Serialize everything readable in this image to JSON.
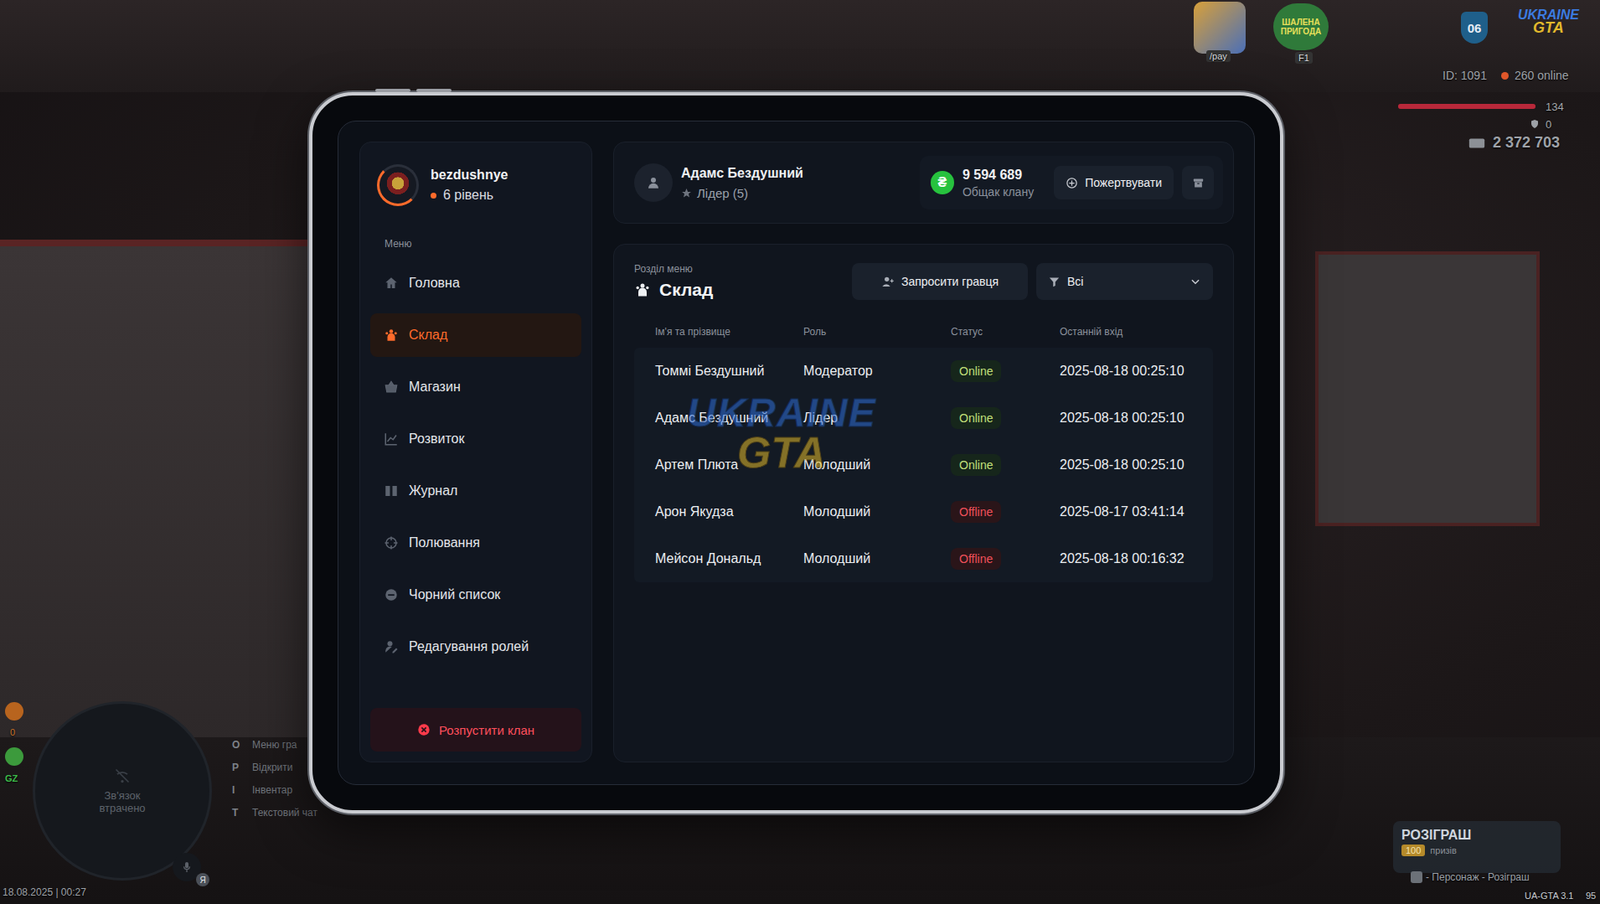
{
  "profile": {
    "name": "bezdushnye",
    "level": "6 рівень"
  },
  "sidebar": {
    "heading": "Меню",
    "items": [
      {
        "label": "Головна",
        "selected": false
      },
      {
        "label": "Склад",
        "selected": true
      },
      {
        "label": "Магазин",
        "selected": false
      },
      {
        "label": "Розвиток",
        "selected": false
      },
      {
        "label": "Журнал",
        "selected": false
      },
      {
        "label": "Полювання",
        "selected": false
      },
      {
        "label": "Чорний список",
        "selected": false
      },
      {
        "label": "Редагування ролей",
        "selected": false
      }
    ],
    "disband": "Розпустити клан"
  },
  "header": {
    "member_name": "Адамс Бездушний",
    "member_role": "Лідер (5)",
    "currency": "₴",
    "balance": "9 594 689",
    "balance_label": "Общак клану",
    "donate": "Пожертвувати"
  },
  "section": {
    "caption": "Розділ меню",
    "title": "Склад",
    "invite": "Запросити гравця",
    "filter": "Всі"
  },
  "table": {
    "columns": [
      "Ім'я та прізвище",
      "Роль",
      "Статус",
      "Останній вхід"
    ],
    "rows": [
      {
        "name": "Томмі Бездушний",
        "role": "Модератор",
        "status": "Online",
        "online": true,
        "last_login": "2025-08-18 00:25:10"
      },
      {
        "name": "Адамс Бездушний",
        "role": "Лідер",
        "status": "Online",
        "online": true,
        "last_login": "2025-08-18 00:25:10"
      },
      {
        "name": "Артем Плюта",
        "role": "Молодший",
        "status": "Online",
        "online": true,
        "last_login": "2025-08-18 00:25:10"
      },
      {
        "name": "Арон Якудза",
        "role": "Молодший",
        "status": "Offline",
        "online": false,
        "last_login": "2025-08-17 03:41:14"
      },
      {
        "name": "Мейсон Дональд",
        "role": "Молодший",
        "status": "Offline",
        "online": false,
        "last_login": "2025-08-18 00:16:32"
      }
    ]
  },
  "watermark": {
    "top": "UKRAINE",
    "bottom": "GTA"
  },
  "hud": {
    "pay_badge": "/pay",
    "event_badge": "ШАЛЕНА ПРИГОДА",
    "event_key": "F1",
    "server_number": "06",
    "logo_top": "UKRAINE",
    "logo_bottom": "GTA",
    "player_id": "ID: 1091",
    "online": "260 online",
    "health": "134",
    "armor": "0",
    "money": "2 372 703",
    "minimap_text": "Зв'язок втрачено",
    "hints": [
      {
        "key": "O",
        "label": "Меню гра"
      },
      {
        "key": "P",
        "label": "Відкрити"
      },
      {
        "key": "I",
        "label": "Інвентар"
      },
      {
        "key": "T",
        "label": "Текстовий чат"
      }
    ],
    "side_counter": "0",
    "zone": "GZ",
    "voice_badge": "Я",
    "datetime": "18.08.2025 | 00:27",
    "giveaway_title": "РОЗІГРАШ",
    "giveaway_count": "100",
    "giveaway_sub": "призів",
    "giveaway_hint": "- Персонаж - Розіграш",
    "version": "UA-GTA 3.1",
    "fps": "95"
  }
}
